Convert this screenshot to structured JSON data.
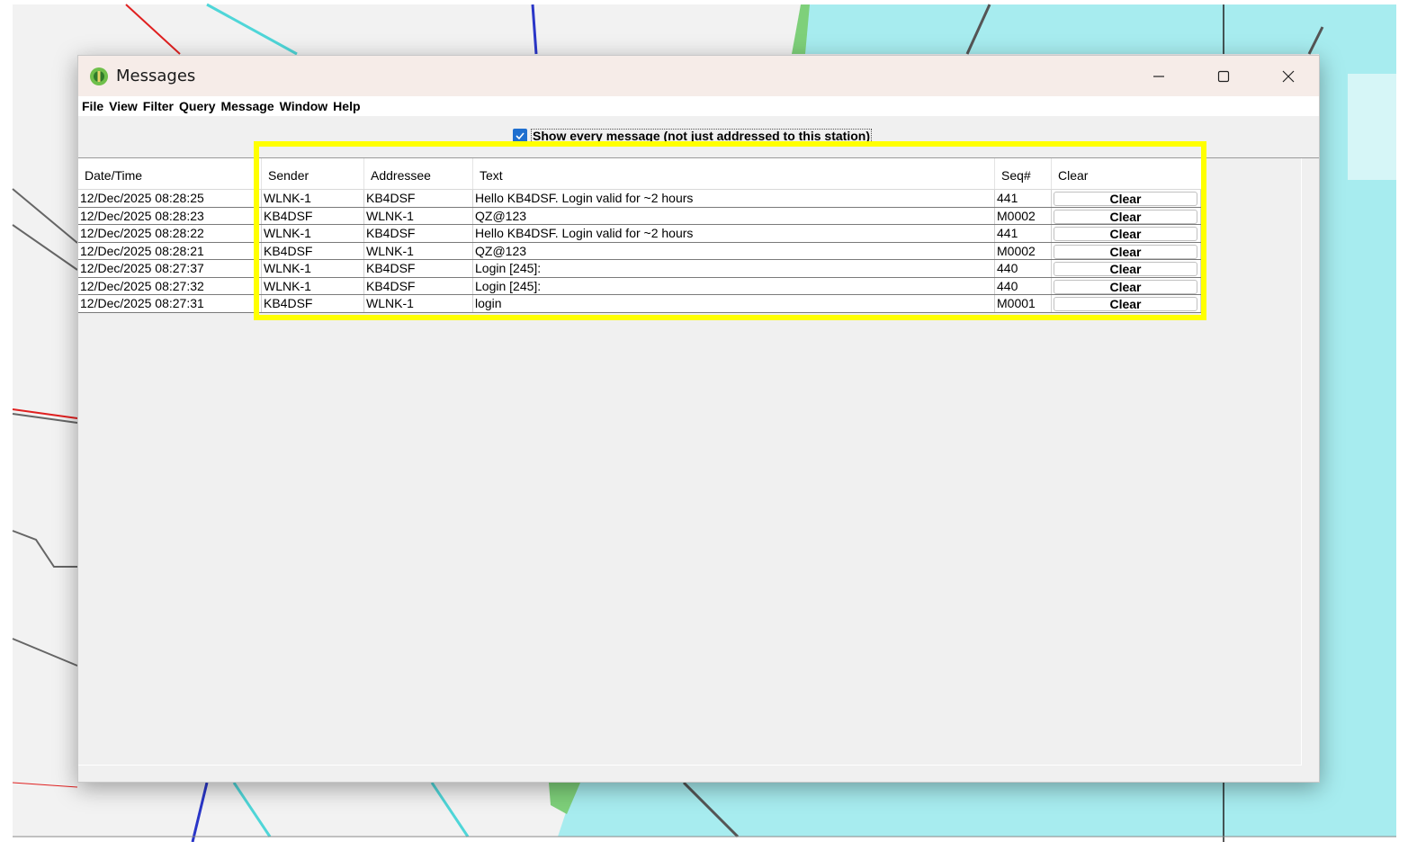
{
  "window": {
    "title": "Messages"
  },
  "menu": [
    "File",
    "View",
    "Filter",
    "Query",
    "Message",
    "Window",
    "Help"
  ],
  "filter": {
    "show_all_label": "Show every message (not just addressed to this station)",
    "show_all_checked": true
  },
  "table": {
    "columns": [
      "Date/Time",
      "Sender",
      "Addressee",
      "Text",
      "Seq#",
      "Clear"
    ],
    "rows": [
      {
        "datetime": "12/Dec/2025 08:28:25",
        "sender": "WLNK-1",
        "addressee": "KB4DSF",
        "text": "Hello KB4DSF. Login valid for ~2 hours",
        "seq": "441",
        "action": "Clear"
      },
      {
        "datetime": "12/Dec/2025 08:28:23",
        "sender": "KB4DSF",
        "addressee": "WLNK-1",
        "text": "QZ@123",
        "seq": "M0002",
        "action": "Clear"
      },
      {
        "datetime": "12/Dec/2025 08:28:22",
        "sender": "WLNK-1",
        "addressee": "KB4DSF",
        "text": "Hello KB4DSF. Login valid for ~2 hours",
        "seq": "441",
        "action": "Clear"
      },
      {
        "datetime": "12/Dec/2025 08:28:21",
        "sender": "KB4DSF",
        "addressee": "WLNK-1",
        "text": "QZ@123",
        "seq": "M0002",
        "action": "Clear"
      },
      {
        "datetime": "12/Dec/2025 08:27:37",
        "sender": "WLNK-1",
        "addressee": "KB4DSF",
        "text": "Login [245]:",
        "seq": "440",
        "action": "Clear"
      },
      {
        "datetime": "12/Dec/2025 08:27:32",
        "sender": "WLNK-1",
        "addressee": "KB4DSF",
        "text": "Login [245]:",
        "seq": "440",
        "action": "Clear"
      },
      {
        "datetime": "12/Dec/2025 08:27:31",
        "sender": "KB4DSF",
        "addressee": "WLNK-1",
        "text": "login",
        "seq": "M0001",
        "action": "Clear"
      }
    ]
  },
  "colors": {
    "highlight": "#ffff00",
    "checkbox": "#1f6fcf",
    "map_water": "#a7ecef"
  }
}
